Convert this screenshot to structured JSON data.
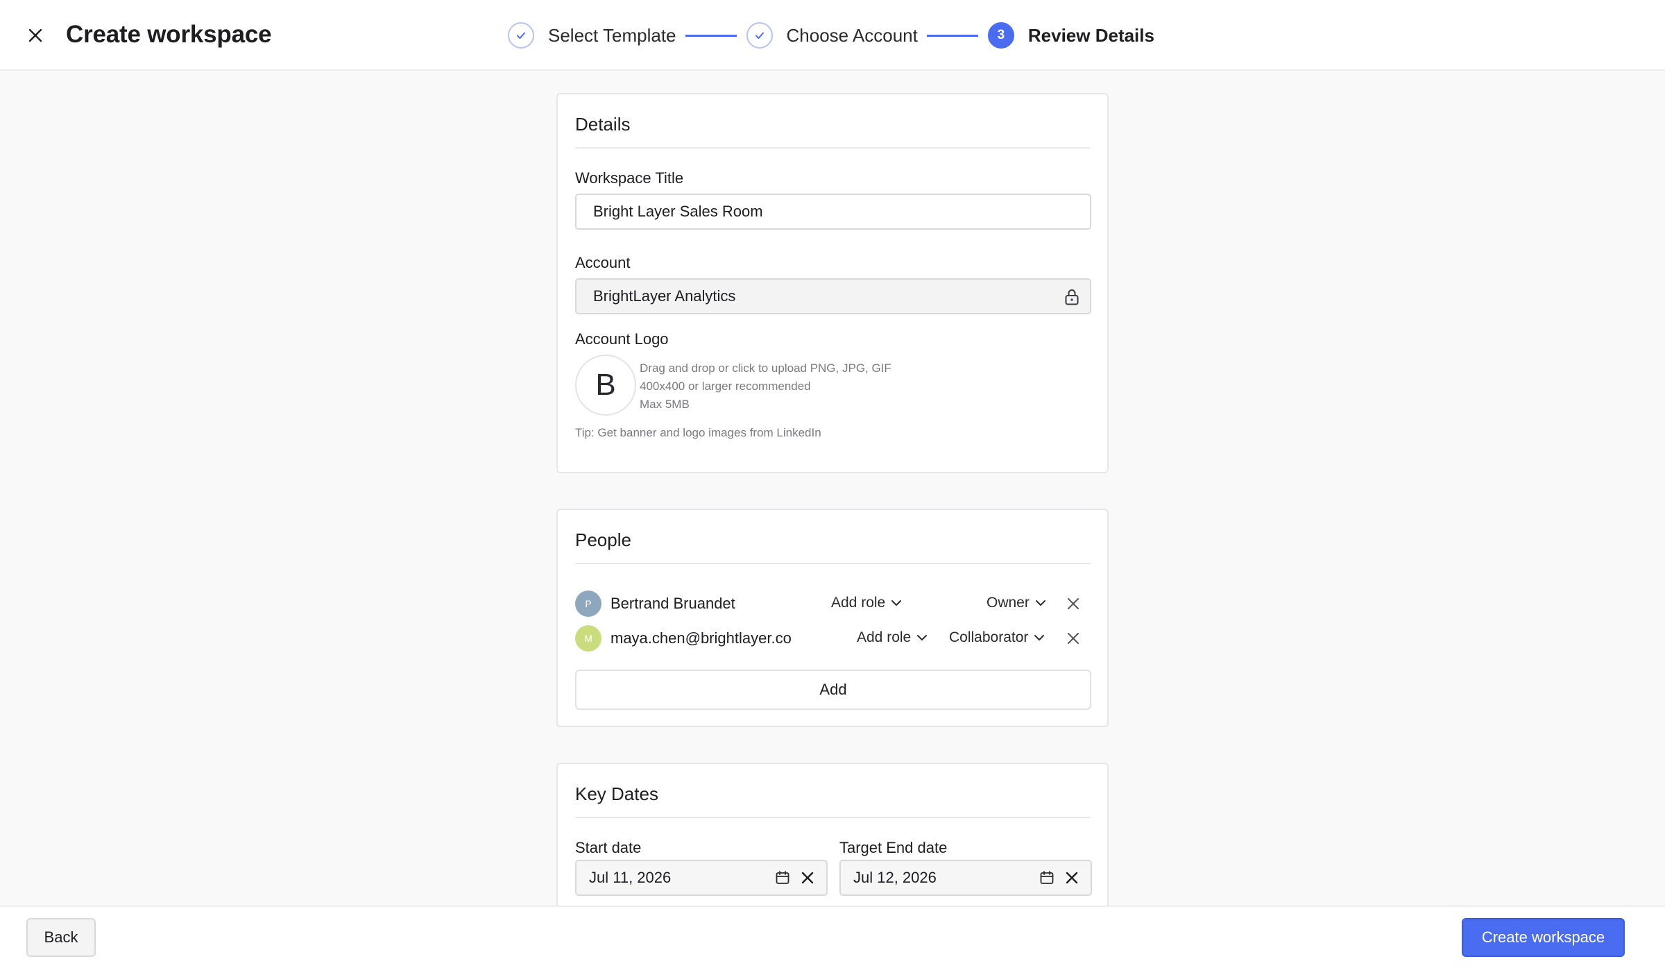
{
  "header": {
    "title": "Create workspace",
    "steps": [
      {
        "label": "Select Template",
        "state": "complete"
      },
      {
        "label": "Choose Account",
        "state": "complete"
      },
      {
        "label": "Review Details",
        "number": "3",
        "state": "active"
      }
    ]
  },
  "details": {
    "title": "Details",
    "workspace_title_label": "Workspace Title",
    "workspace_title_value": "Bright Layer Sales Room",
    "account_label": "Account",
    "account_value": "BrightLayer Analytics",
    "account_logo_label": "Account Logo",
    "logo_letter": "B",
    "upload_hint_1": "Drag and drop or click to upload PNG, JPG, GIF",
    "upload_hint_2": "400x400 or larger recommended",
    "upload_hint_3": "Max 5MB",
    "tip": "Tip: Get banner and logo images from LinkedIn"
  },
  "people": {
    "title": "People",
    "members": [
      {
        "initial": "P",
        "name": "Bertrand Bruandet",
        "role_label": "Add role",
        "permission": "Owner",
        "avatar_color": "#8fa7bd"
      },
      {
        "initial": "M",
        "name": "maya.chen@brightlayer.co",
        "role_label": "Add role",
        "permission": "Collaborator",
        "avatar_color": "#c9dc7e"
      }
    ],
    "add_label": "Add"
  },
  "key_dates": {
    "title": "Key Dates",
    "start_label": "Start date",
    "start_value": "Jul 11, 2026",
    "end_label": "Target End date",
    "end_value": "Jul 12, 2026"
  },
  "footer": {
    "back_label": "Back",
    "create_label": "Create workspace"
  },
  "colors": {
    "accent": "#4a6cf0",
    "background": "#f9f9f9"
  }
}
